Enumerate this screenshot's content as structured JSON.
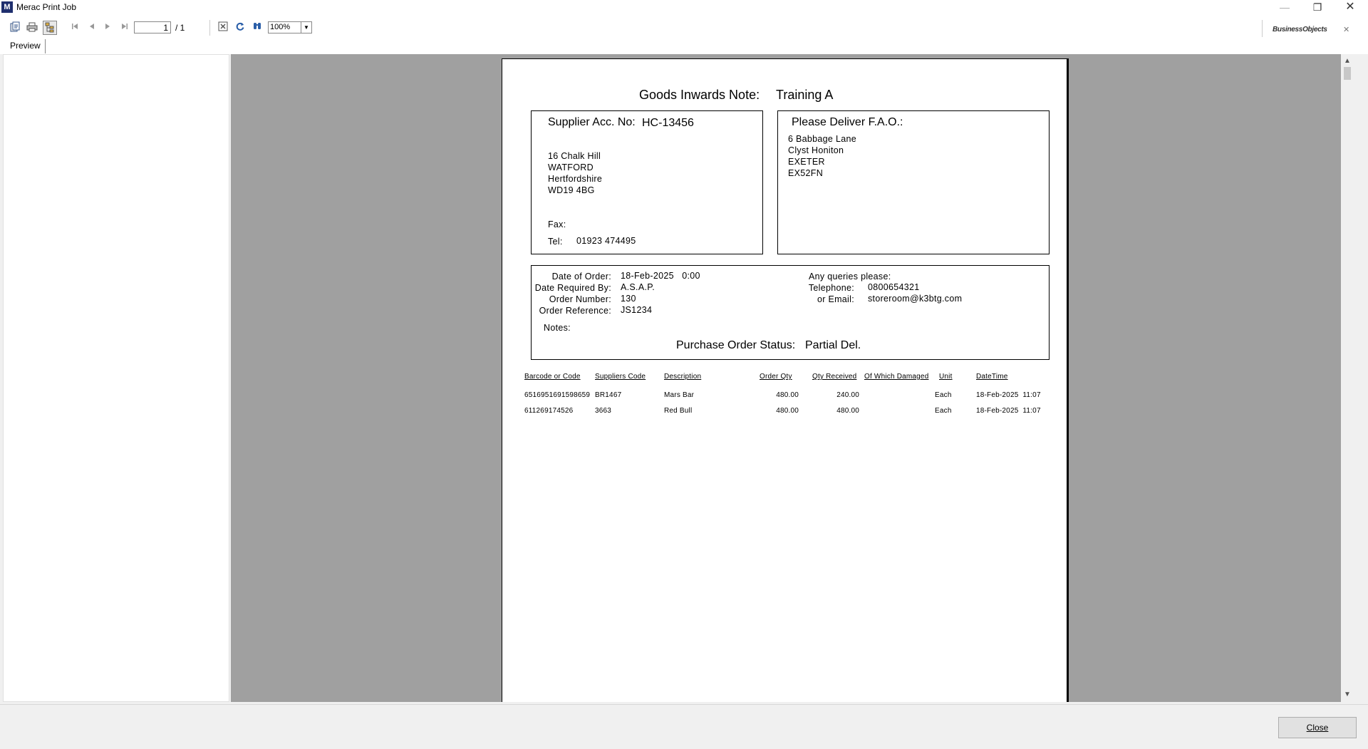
{
  "window": {
    "title": "Merac Print Job",
    "app_icon_text": "M",
    "minimize_glyph": "—",
    "maximize_glyph": "❐",
    "close_glyph": "✕"
  },
  "toolbar": {
    "icons": [
      "export-icon",
      "print-icon",
      "group-tree-icon",
      "first-page-icon",
      "previous-page-icon",
      "next-page-icon",
      "last-page-icon",
      "stop-icon",
      "refresh-icon",
      "search-icon"
    ],
    "page_current": "1",
    "page_total": "/ 1",
    "zoom": "100%",
    "brand": "BusinessObjects",
    "close_glyph": "✕"
  },
  "tabs": {
    "preview": "Preview"
  },
  "report": {
    "heading_label": "Goods Inwards Note:",
    "heading_value": "Training A",
    "supplier": {
      "acc_label": "Supplier Acc. No:",
      "acc_value": "HC-13456",
      "address": [
        "16 Chalk Hill",
        "WATFORD",
        "Hertfordshire",
        "WD19 4BG"
      ],
      "fax_label": "Fax:",
      "fax_value": "",
      "tel_label": "Tel:",
      "tel_value": "01923 474495"
    },
    "deliver": {
      "title": "Please Deliver F.A.O.:",
      "address": [
        "6 Babbage Lane",
        "Clyst Honiton",
        "EXETER",
        "EX52FN"
      ]
    },
    "order": {
      "date_of_order_label": "Date of Order:",
      "date_of_order": "18-Feb-2025   0:00",
      "date_required_label": "Date Required By:",
      "date_required": "A.S.A.P.",
      "order_number_label": "Order Number:",
      "order_number": "130",
      "order_reference_label": "Order Reference:",
      "order_reference": "JS1234",
      "notes_label": "Notes:",
      "queries_label": "Any queries please:",
      "telephone_label": "Telephone:",
      "telephone": "0800654321",
      "email_label": "or Email:",
      "email": "storeroom@k3btg.com",
      "status_label": "Purchase Order Status:",
      "status_value": "Partial Del."
    },
    "table": {
      "headers": [
        "Barcode or Code",
        "Suppliers Code",
        "Description",
        "Order Qty",
        "Qty Received",
        "Of Which Damaged",
        "Unit",
        "DateTime"
      ],
      "rows": [
        [
          "6516951691598659",
          "BR1467",
          "Mars Bar",
          "480.00",
          "240.00",
          "",
          "Each",
          "18-Feb-2025  11:07"
        ],
        [
          "611269174526",
          "3663",
          "Red Bull",
          "480.00",
          "480.00",
          "",
          "Each",
          "18-Feb-2025  11:07"
        ]
      ]
    }
  },
  "footer": {
    "close_label": "Close"
  },
  "scrollbar": {
    "up": "▲",
    "down": "▼"
  }
}
